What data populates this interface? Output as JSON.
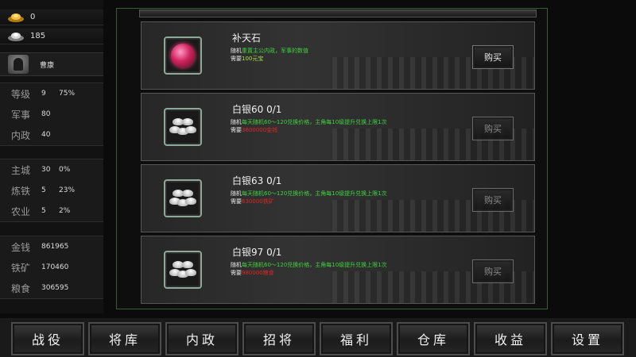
{
  "resources": {
    "gold": {
      "icon": "gold-ingot-icon",
      "value": "0"
    },
    "silver": {
      "icon": "silver-ingot-icon",
      "value": "185"
    }
  },
  "general": {
    "icon": "general-avatar-icon",
    "name": "曹康"
  },
  "stats_a": [
    {
      "label": "等级",
      "v1": "9",
      "v2": "75%"
    },
    {
      "label": "军事",
      "v1": "80",
      "v2": ""
    },
    {
      "label": "内政",
      "v1": "40",
      "v2": ""
    }
  ],
  "stats_b": [
    {
      "label": "主城",
      "v1": "30",
      "v2": "0%"
    },
    {
      "label": "炼铁",
      "v1": "5",
      "v2": "23%"
    },
    {
      "label": "农业",
      "v1": "5",
      "v2": "2%"
    }
  ],
  "stats_c": [
    {
      "label": "金钱",
      "v1": "861965"
    },
    {
      "label": "铁矿",
      "v1": "170460"
    },
    {
      "label": "粮食",
      "v1": "306595"
    }
  ],
  "items": [
    {
      "icon": "red-gem-icon",
      "title": "补天石",
      "desc_prefix": "随机",
      "desc_green": "重置主公内政，军事的数值",
      "cost_prefix": "需要",
      "cost_value": "100元宝",
      "buy": "购买"
    },
    {
      "icon": "silver-ingots-icon",
      "title": "白银60 0/1",
      "desc_prefix": "随机",
      "desc_green": "每天随机60～120兑换价格，主角每10级提升兑换上限1次",
      "cost_prefix": "需要",
      "cost_value": "3600000金钱",
      "buy": "购买"
    },
    {
      "icon": "silver-ingots-icon",
      "title": "白银63 0/1",
      "desc_prefix": "随机",
      "desc_green": "每天随机60～120兑换价格，主角每10级提升兑换上限1次",
      "cost_prefix": "需要",
      "cost_value": "630000铁矿",
      "buy": "购买"
    },
    {
      "icon": "silver-ingots-icon",
      "title": "白银97 0/1",
      "desc_prefix": "随机",
      "desc_green": "每天随机60～120兑换价格，主角每10级提升兑换上限1次",
      "cost_prefix": "需要",
      "cost_value": "980000粮食",
      "buy": "购买"
    }
  ],
  "nav": [
    "战役",
    "将库",
    "内政",
    "招将",
    "福利",
    "仓库",
    "收益",
    "设置"
  ],
  "colors": {
    "desc_green": "#3fd23f",
    "cost_red": "#e02525",
    "frame_border": "#3d5a3d"
  }
}
